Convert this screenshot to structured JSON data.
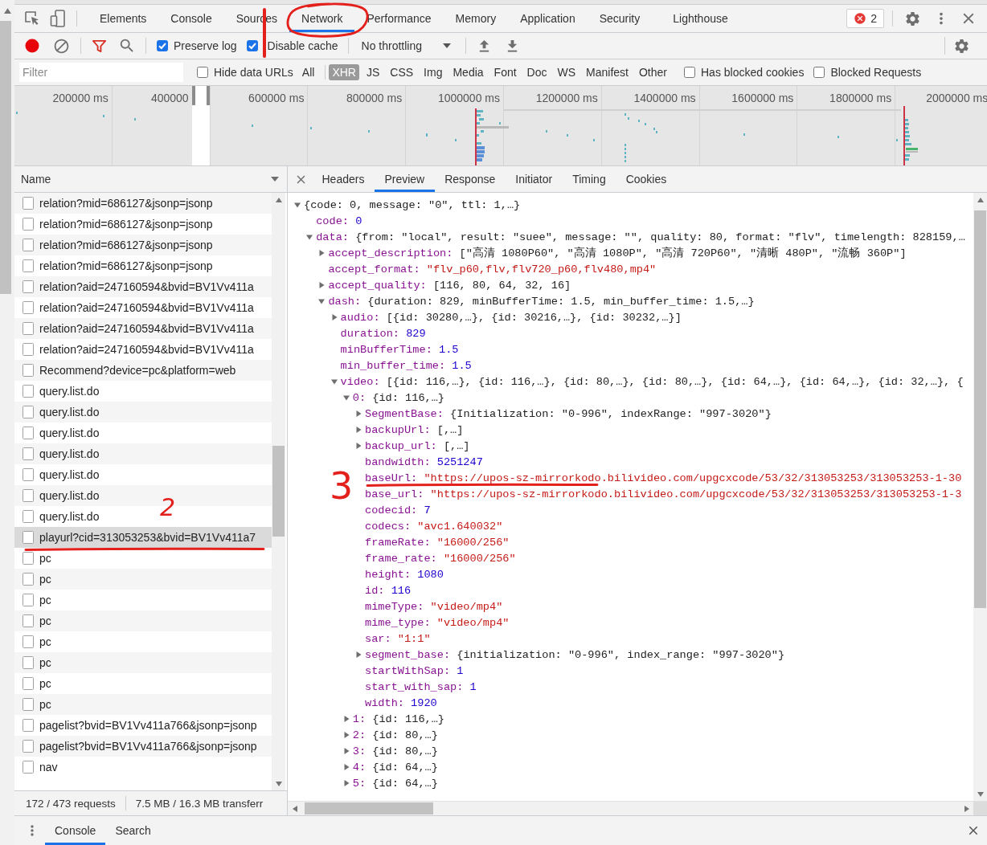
{
  "main_tabs": [
    {
      "label": "Elements",
      "selected": false
    },
    {
      "label": "Console",
      "selected": false
    },
    {
      "label": "Sources",
      "selected": false
    },
    {
      "label": "Network",
      "selected": true
    },
    {
      "label": "Performance",
      "selected": false
    },
    {
      "label": "Memory",
      "selected": false
    },
    {
      "label": "Application",
      "selected": false
    },
    {
      "label": "Security",
      "selected": false
    },
    {
      "label": "Lighthouse",
      "selected": false
    }
  ],
  "error_count": "2",
  "network_toolbar": {
    "checkboxes": [
      {
        "label": "Preserve log",
        "checked": true
      },
      {
        "label": "Disable cache",
        "checked": true
      }
    ],
    "throttling": "No throttling"
  },
  "filter_bar": {
    "filter": {
      "placeholder": "Filter"
    },
    "hide_data_urls": {
      "label": "Hide data URLs",
      "checked": false
    },
    "types": [
      {
        "label": "All",
        "selected": false
      },
      {
        "label": "XHR",
        "selected": true
      },
      {
        "label": "JS",
        "selected": false
      },
      {
        "label": "CSS",
        "selected": false
      },
      {
        "label": "Img",
        "selected": false
      },
      {
        "label": "Media",
        "selected": false
      },
      {
        "label": "Font",
        "selected": false
      },
      {
        "label": "Doc",
        "selected": false
      },
      {
        "label": "WS",
        "selected": false
      },
      {
        "label": "Manifest",
        "selected": false
      },
      {
        "label": "Other",
        "selected": false
      }
    ],
    "options": [
      {
        "label": "Has blocked cookies",
        "checked": false
      },
      {
        "label": "Blocked Requests",
        "checked": false
      }
    ]
  },
  "overview": {
    "ticks": [
      {
        "label": "200000 ms",
        "window": false
      },
      {
        "label": "400000",
        "window": true
      },
      {
        "label": "600000 ms",
        "window": false
      },
      {
        "label": "800000 ms",
        "window": false
      },
      {
        "label": "1000000 ms",
        "window": false
      },
      {
        "label": "1200000 ms",
        "window": false
      },
      {
        "label": "1400000 ms",
        "window": false
      },
      {
        "label": "1600000 ms",
        "window": false
      },
      {
        "label": "1800000 ms",
        "window": false
      },
      {
        "label": "2000000 ms",
        "window": false
      }
    ]
  },
  "requests": {
    "column": "Name",
    "rows": [
      {
        "name": "relation?mid=686127&jsonp=jsonp",
        "selected": false
      },
      {
        "name": "relation?mid=686127&jsonp=jsonp",
        "selected": false
      },
      {
        "name": "relation?mid=686127&jsonp=jsonp",
        "selected": false
      },
      {
        "name": "relation?mid=686127&jsonp=jsonp",
        "selected": false
      },
      {
        "name": "relation?aid=247160594&bvid=BV1Vv411a",
        "selected": false
      },
      {
        "name": "relation?aid=247160594&bvid=BV1Vv411a",
        "selected": false
      },
      {
        "name": "relation?aid=247160594&bvid=BV1Vv411a",
        "selected": false
      },
      {
        "name": "relation?aid=247160594&bvid=BV1Vv411a",
        "selected": false
      },
      {
        "name": "Recommend?device=pc&platform=web",
        "selected": false
      },
      {
        "name": "query.list.do",
        "selected": false
      },
      {
        "name": "query.list.do",
        "selected": false
      },
      {
        "name": "query.list.do",
        "selected": false
      },
      {
        "name": "query.list.do",
        "selected": false
      },
      {
        "name": "query.list.do",
        "selected": false
      },
      {
        "name": "query.list.do",
        "selected": false
      },
      {
        "name": "query.list.do",
        "selected": false
      },
      {
        "name": "playurl?cid=313053253&bvid=BV1Vv411a7",
        "selected": true
      },
      {
        "name": "pc",
        "selected": false
      },
      {
        "name": "pc",
        "selected": false
      },
      {
        "name": "pc",
        "selected": false
      },
      {
        "name": "pc",
        "selected": false
      },
      {
        "name": "pc",
        "selected": false
      },
      {
        "name": "pc",
        "selected": false
      },
      {
        "name": "pc",
        "selected": false
      },
      {
        "name": "pc",
        "selected": false
      },
      {
        "name": "pagelist?bvid=BV1Vv411a766&jsonp=jsonp",
        "selected": false
      },
      {
        "name": "pagelist?bvid=BV1Vv411a766&jsonp=jsonp",
        "selected": false
      },
      {
        "name": "nav",
        "selected": false
      }
    ],
    "summary": {
      "requests": "172 / 473 requests",
      "transferred": "7.5 MB / 16.3 MB transferr"
    }
  },
  "details": {
    "tabs": [
      {
        "label": "Headers",
        "selected": false
      },
      {
        "label": "Preview",
        "selected": true
      },
      {
        "label": "Response",
        "selected": false
      },
      {
        "label": "Initiator",
        "selected": false
      },
      {
        "label": "Timing",
        "selected": false
      },
      {
        "label": "Cookies",
        "selected": false
      }
    ],
    "tree": {
      "kind": "object",
      "expanded": true,
      "summary": "{code: 0, message: \"0\", ttl: 1,…}",
      "children": [
        {
          "key": "code:",
          "kind": "number",
          "value": "0"
        },
        {
          "key": "data:",
          "kind": "object",
          "expanded": true,
          "summary": "{from: \"local\", result: \"suee\", message: \"\", quality: 80, format: \"flv\", timelength: 828159,…",
          "children": [
            {
              "key": "accept_description:",
              "kind": "object",
              "expanded": false,
              "summary": "[\"高清 1080P60\", \"高清 1080P\", \"高清 720P60\", \"清晰 480P\", \"流畅 360P\"]"
            },
            {
              "key": "accept_format:",
              "kind": "string",
              "value": "\"flv_p60,flv,flv720_p60,flv480,mp4\""
            },
            {
              "key": "accept_quality:",
              "kind": "object",
              "expanded": false,
              "summary": "[116, 80, 64, 32, 16]"
            },
            {
              "key": "dash:",
              "kind": "object",
              "expanded": true,
              "summary": "{duration: 829, minBufferTime: 1.5, min_buffer_time: 1.5,…}",
              "children": [
                {
                  "key": "audio:",
                  "kind": "object",
                  "expanded": false,
                  "summary": "[{id: 30280,…}, {id: 30216,…}, {id: 30232,…}]"
                },
                {
                  "key": "duration:",
                  "kind": "number",
                  "value": "829"
                },
                {
                  "key": "minBufferTime:",
                  "kind": "number",
                  "value": "1.5"
                },
                {
                  "key": "min_buffer_time:",
                  "kind": "number",
                  "value": "1.5"
                },
                {
                  "key": "video:",
                  "kind": "object",
                  "expanded": true,
                  "summary": "[{id: 116,…}, {id: 116,…}, {id: 80,…}, {id: 80,…}, {id: 64,…}, {id: 64,…}, {id: 32,…}, {",
                  "children": [
                    {
                      "key": "0:",
                      "kind": "object",
                      "expanded": true,
                      "summary": "{id: 116,…}",
                      "children": [
                        {
                          "key": "SegmentBase:",
                          "kind": "object",
                          "expanded": false,
                          "summary": "{Initialization: \"0-996\", indexRange: \"997-3020\"}"
                        },
                        {
                          "key": "backupUrl:",
                          "kind": "object",
                          "expanded": false,
                          "summary": "[,…]"
                        },
                        {
                          "key": "backup_url:",
                          "kind": "object",
                          "expanded": false,
                          "summary": "[,…]"
                        },
                        {
                          "key": "bandwidth:",
                          "kind": "number",
                          "value": "5251247"
                        },
                        {
                          "key": "baseUrl:",
                          "kind": "string",
                          "value": "\"https://upos-sz-mirrorkodo.bilivideo.com/upgcxcode/53/32/313053253/313053253-1-30"
                        },
                        {
                          "key": "base_url:",
                          "kind": "string",
                          "value": "\"https://upos-sz-mirrorkodo.bilivideo.com/upgcxcode/53/32/313053253/313053253-1-3"
                        },
                        {
                          "key": "codecid:",
                          "kind": "number",
                          "value": "7"
                        },
                        {
                          "key": "codecs:",
                          "kind": "string",
                          "value": "\"avc1.640032\""
                        },
                        {
                          "key": "frameRate:",
                          "kind": "string",
                          "value": "\"16000/256\""
                        },
                        {
                          "key": "frame_rate:",
                          "kind": "string",
                          "value": "\"16000/256\""
                        },
                        {
                          "key": "height:",
                          "kind": "number",
                          "value": "1080"
                        },
                        {
                          "key": "id:",
                          "kind": "number",
                          "value": "116"
                        },
                        {
                          "key": "mimeType:",
                          "kind": "string",
                          "value": "\"video/mp4\""
                        },
                        {
                          "key": "mime_type:",
                          "kind": "string",
                          "value": "\"video/mp4\""
                        },
                        {
                          "key": "sar:",
                          "kind": "string",
                          "value": "\"1:1\""
                        },
                        {
                          "key": "segment_base:",
                          "kind": "object",
                          "expanded": false,
                          "summary": "{initialization: \"0-996\", index_range: \"997-3020\"}"
                        },
                        {
                          "key": "startWithSap:",
                          "kind": "number",
                          "value": "1"
                        },
                        {
                          "key": "start_with_sap:",
                          "kind": "number",
                          "value": "1"
                        },
                        {
                          "key": "width:",
                          "kind": "number",
                          "value": "1920"
                        }
                      ]
                    },
                    {
                      "key": "1:",
                      "kind": "object",
                      "expanded": false,
                      "summary": "{id: 116,…}"
                    },
                    {
                      "key": "2:",
                      "kind": "object",
                      "expanded": false,
                      "summary": "{id: 80,…}"
                    },
                    {
                      "key": "3:",
                      "kind": "object",
                      "expanded": false,
                      "summary": "{id: 80,…}"
                    },
                    {
                      "key": "4:",
                      "kind": "object",
                      "expanded": false,
                      "summary": "{id: 64,…}"
                    },
                    {
                      "key": "5:",
                      "kind": "object",
                      "expanded": false,
                      "summary": "{id: 64,…}"
                    }
                  ]
                }
              ]
            }
          ]
        }
      ]
    }
  },
  "drawer": {
    "tabs": [
      {
        "label": "Console",
        "selected": true
      },
      {
        "label": "Search",
        "selected": false
      }
    ]
  },
  "annotations": [
    {
      "kind": "circle"
    },
    {
      "kind": "stroke"
    },
    {
      "kind": "number",
      "label": "2"
    },
    {
      "kind": "underline"
    },
    {
      "kind": "number",
      "label": "3"
    },
    {
      "kind": "underline"
    }
  ]
}
